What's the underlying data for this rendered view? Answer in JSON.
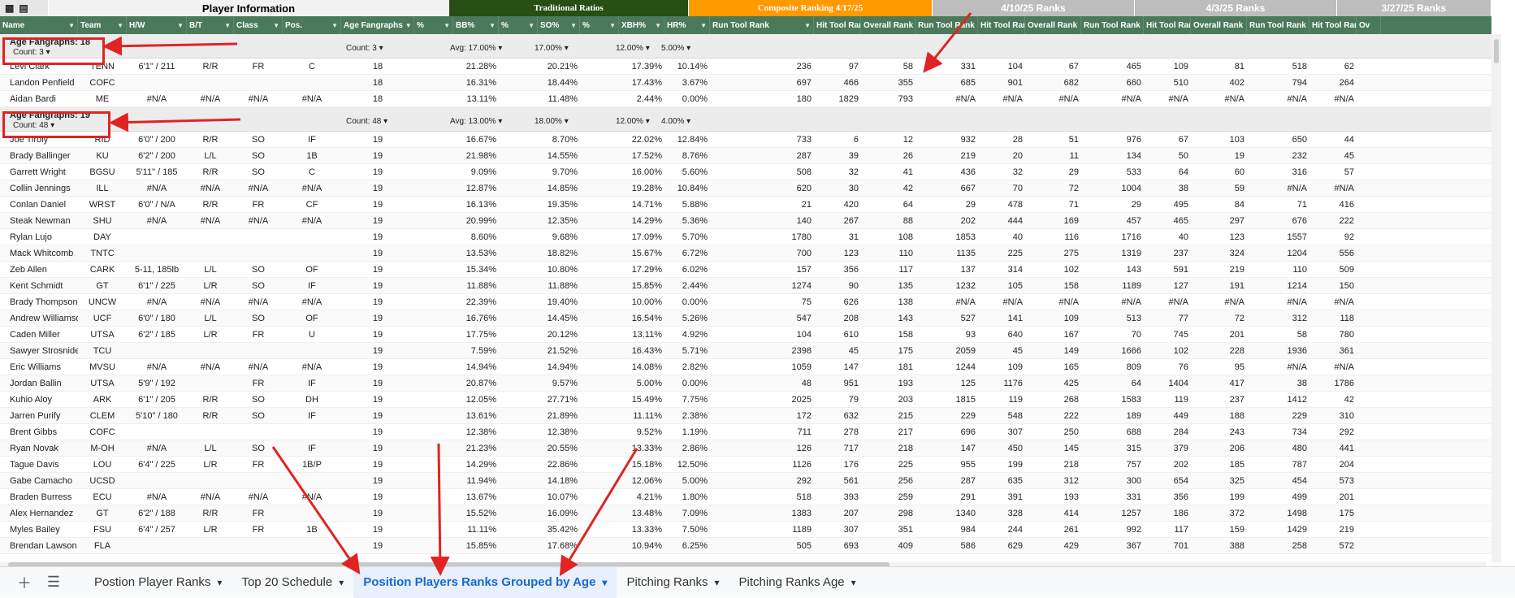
{
  "bands": {
    "player": "Player Information",
    "trad": "Traditional Ratios",
    "comp": "Composite Ranking 4/17/25",
    "r1": "4/10/25 Ranks",
    "r2": "4/3/25 Ranks",
    "r3": "3/27/25 Ranks"
  },
  "headers": [
    "Name",
    "Team",
    "H/W",
    "B/T",
    "Class",
    "Pos.",
    "Age Fangraphs",
    "%",
    "BB%",
    "%",
    "SO%",
    "%",
    "XBH%",
    "HR%",
    "Run Tool Rank",
    "Hit Tool Rank",
    "Overall Rank",
    "Run Tool Rank",
    "Hit Tool Rank",
    "Overall Rank",
    "Run Tool Rank",
    "Hit Tool Rank",
    "Overall Rank",
    "Run Tool Rank",
    "Hit Tool Rank",
    "Ov"
  ],
  "groups": [
    {
      "title": "Age Fangraphs: 18",
      "count": "Count: 3",
      "agg": [
        "Count: 3",
        "Avg: 17.00%",
        "17.00%",
        "12.00%",
        "5.00%"
      ],
      "rows": [
        [
          "Levi Clark",
          "TENN",
          "6'1\" / 211",
          "R/R",
          "FR",
          "C",
          "18",
          "21.28%",
          "20.21%",
          "17.39%",
          "10.14%",
          "236",
          "97",
          "58",
          "331",
          "104",
          "67",
          "465",
          "109",
          "81",
          "518",
          "62"
        ],
        [
          "Landon Penfield",
          "COFC",
          "",
          "",
          "",
          "",
          "18",
          "16.31%",
          "18.44%",
          "17.43%",
          "3.67%",
          "697",
          "466",
          "355",
          "685",
          "901",
          "682",
          "660",
          "510",
          "402",
          "794",
          "264"
        ],
        [
          "Aidan Bardi",
          "ME",
          "#N/A",
          "#N/A",
          "#N/A",
          "#N/A",
          "18",
          "13.11%",
          "11.48%",
          "2.44%",
          "0.00%",
          "180",
          "1829",
          "793",
          "#N/A",
          "#N/A",
          "#N/A",
          "#N/A",
          "#N/A",
          "#N/A",
          "#N/A",
          "#N/A"
        ]
      ]
    },
    {
      "title": "Age Fangraphs: 19",
      "count": "Count: 48",
      "agg": [
        "Count: 48",
        "Avg: 13.00%",
        "18.00%",
        "12.00%",
        "4.00%"
      ],
      "rows": [
        [
          "Joe Tiroly",
          "RID",
          "6'0\" / 200",
          "R/R",
          "SO",
          "IF",
          "19",
          "16.67%",
          "8.70%",
          "22.02%",
          "12.84%",
          "733",
          "6",
          "12",
          "932",
          "28",
          "51",
          "976",
          "67",
          "103",
          "650",
          "44"
        ],
        [
          "Brady Ballinger",
          "KU",
          "6'2\" / 200",
          "L/L",
          "SO",
          "1B",
          "19",
          "21.98%",
          "14.55%",
          "17.52%",
          "8.76%",
          "287",
          "39",
          "26",
          "219",
          "20",
          "11",
          "134",
          "50",
          "19",
          "232",
          "45"
        ],
        [
          "Garrett Wright",
          "BGSU",
          "5'11\" / 185",
          "R/R",
          "SO",
          "C",
          "19",
          "9.09%",
          "9.70%",
          "16.00%",
          "5.60%",
          "508",
          "32",
          "41",
          "436",
          "32",
          "29",
          "533",
          "64",
          "60",
          "316",
          "57"
        ],
        [
          "Collin Jennings",
          "ILL",
          "#N/A",
          "#N/A",
          "#N/A",
          "#N/A",
          "19",
          "12.87%",
          "14.85%",
          "19.28%",
          "10.84%",
          "620",
          "30",
          "42",
          "667",
          "70",
          "72",
          "1004",
          "38",
          "59",
          "#N/A",
          "#N/A"
        ],
        [
          "Conlan Daniel",
          "WRST",
          "6'0\" / N/A",
          "R/R",
          "FR",
          "CF",
          "19",
          "16.13%",
          "19.35%",
          "14.71%",
          "5.88%",
          "21",
          "420",
          "64",
          "29",
          "478",
          "71",
          "29",
          "495",
          "84",
          "71",
          "416"
        ],
        [
          "Steak Newman",
          "SHU",
          "#N/A",
          "#N/A",
          "#N/A",
          "#N/A",
          "19",
          "20.99%",
          "12.35%",
          "14.29%",
          "5.36%",
          "140",
          "267",
          "88",
          "202",
          "444",
          "169",
          "457",
          "465",
          "297",
          "676",
          "222"
        ],
        [
          "Rylan Lujo",
          "DAY",
          "",
          "",
          "",
          "",
          "19",
          "8.60%",
          "9.68%",
          "17.09%",
          "5.70%",
          "1780",
          "31",
          "108",
          "1853",
          "40",
          "116",
          "1716",
          "40",
          "123",
          "1557",
          "92"
        ],
        [
          "Mack Whitcomb",
          "TNTC",
          "",
          "",
          "",
          "",
          "19",
          "13.53%",
          "18.82%",
          "15.67%",
          "6.72%",
          "700",
          "123",
          "110",
          "1135",
          "225",
          "275",
          "1319",
          "237",
          "324",
          "1204",
          "556"
        ],
        [
          "Zeb Allen",
          "CARK",
          "5-11, 185lb",
          "L/L",
          "SO",
          "OF",
          "19",
          "15.34%",
          "10.80%",
          "17.29%",
          "6.02%",
          "157",
          "356",
          "117",
          "137",
          "314",
          "102",
          "143",
          "591",
          "219",
          "110",
          "509"
        ],
        [
          "Kent Schmidt",
          "GT",
          "6'1\" / 225",
          "L/R",
          "SO",
          "IF",
          "19",
          "11.88%",
          "11.88%",
          "15.85%",
          "2.44%",
          "1274",
          "90",
          "135",
          "1232",
          "105",
          "158",
          "1189",
          "127",
          "191",
          "1214",
          "150"
        ],
        [
          "Brady Thompson",
          "UNCW",
          "#N/A",
          "#N/A",
          "#N/A",
          "#N/A",
          "19",
          "22.39%",
          "19.40%",
          "10.00%",
          "0.00%",
          "75",
          "626",
          "138",
          "#N/A",
          "#N/A",
          "#N/A",
          "#N/A",
          "#N/A",
          "#N/A",
          "#N/A",
          "#N/A"
        ],
        [
          "Andrew Williamson",
          "UCF",
          "6'0\" / 180",
          "L/L",
          "SO",
          "OF",
          "19",
          "16.76%",
          "14.45%",
          "16.54%",
          "5.26%",
          "547",
          "208",
          "143",
          "527",
          "141",
          "109",
          "513",
          "77",
          "72",
          "312",
          "118"
        ],
        [
          "Caden Miller",
          "UTSA",
          "6'2\" / 185",
          "L/R",
          "FR",
          "U",
          "19",
          "17.75%",
          "20.12%",
          "13.11%",
          "4.92%",
          "104",
          "610",
          "158",
          "93",
          "640",
          "167",
          "70",
          "745",
          "201",
          "58",
          "780"
        ],
        [
          "Sawyer Strosnider",
          "TCU",
          "",
          "",
          "",
          "",
          "19",
          "7.59%",
          "21.52%",
          "16.43%",
          "5.71%",
          "2398",
          "45",
          "175",
          "2059",
          "45",
          "149",
          "1666",
          "102",
          "228",
          "1936",
          "361"
        ],
        [
          "Eric Williams",
          "MVSU",
          "#N/A",
          "#N/A",
          "#N/A",
          "#N/A",
          "19",
          "14.94%",
          "14.94%",
          "14.08%",
          "2.82%",
          "1059",
          "147",
          "181",
          "1244",
          "109",
          "165",
          "809",
          "76",
          "95",
          "#N/A",
          "#N/A"
        ],
        [
          "Jordan Ballin",
          "UTSA",
          "5'9\" / 192",
          "",
          "FR",
          "IF",
          "19",
          "20.87%",
          "9.57%",
          "5.00%",
          "0.00%",
          "48",
          "951",
          "193",
          "125",
          "1176",
          "425",
          "64",
          "1404",
          "417",
          "38",
          "1786"
        ],
        [
          "Kuhio Aloy",
          "ARK",
          "6'1\" / 205",
          "R/R",
          "SO",
          "DH",
          "19",
          "12.05%",
          "27.71%",
          "15.49%",
          "7.75%",
          "2025",
          "79",
          "203",
          "1815",
          "119",
          "268",
          "1583",
          "119",
          "237",
          "1412",
          "42"
        ],
        [
          "Jarren Purify",
          "CLEM",
          "5'10\" / 180",
          "R/R",
          "SO",
          "IF",
          "19",
          "13.61%",
          "21.89%",
          "11.11%",
          "2.38%",
          "172",
          "632",
          "215",
          "229",
          "548",
          "222",
          "189",
          "449",
          "188",
          "229",
          "310"
        ],
        [
          "Brent Gibbs",
          "COFC",
          "",
          "",
          "",
          "",
          "19",
          "12.38%",
          "12.38%",
          "9.52%",
          "1.19%",
          "711",
          "278",
          "217",
          "696",
          "307",
          "250",
          "688",
          "284",
          "243",
          "734",
          "292"
        ],
        [
          "Ryan Novak",
          "M-OH",
          "#N/A",
          "L/L",
          "SO",
          "IF",
          "19",
          "21.23%",
          "20.55%",
          "13.33%",
          "2.86%",
          "126",
          "717",
          "218",
          "147",
          "450",
          "145",
          "315",
          "379",
          "206",
          "480",
          "441"
        ],
        [
          "Tague Davis",
          "LOU",
          "6'4\" / 225",
          "L/R",
          "FR",
          "1B/P",
          "19",
          "14.29%",
          "22.86%",
          "15.18%",
          "12.50%",
          "1126",
          "176",
          "225",
          "955",
          "199",
          "218",
          "757",
          "202",
          "185",
          "787",
          "204"
        ],
        [
          "Gabe Camacho",
          "UCSD",
          "",
          "",
          "",
          "",
          "19",
          "11.94%",
          "14.18%",
          "12.06%",
          "5.00%",
          "292",
          "561",
          "256",
          "287",
          "635",
          "312",
          "300",
          "654",
          "325",
          "454",
          "573"
        ],
        [
          "Braden Burress",
          "ECU",
          "#N/A",
          "#N/A",
          "#N/A",
          "#N/A",
          "19",
          "13.67%",
          "10.07%",
          "4.21%",
          "1.80%",
          "518",
          "393",
          "259",
          "291",
          "391",
          "193",
          "331",
          "356",
          "199",
          "499",
          "201"
        ],
        [
          "Alex Hernandez",
          "GT",
          "6'2\" / 188",
          "R/R",
          "FR",
          "",
          "19",
          "15.52%",
          "16.09%",
          "13.48%",
          "7.09%",
          "1383",
          "207",
          "298",
          "1340",
          "328",
          "414",
          "1257",
          "186",
          "372",
          "1498",
          "175"
        ],
        [
          "Myles Bailey",
          "FSU",
          "6'4\" / 257",
          "L/R",
          "FR",
          "1B",
          "19",
          "11.11%",
          "35.42%",
          "13.33%",
          "7.50%",
          "1189",
          "307",
          "351",
          "984",
          "244",
          "261",
          "992",
          "117",
          "159",
          "1429",
          "219"
        ],
        [
          "Brendan Lawson",
          "FLA",
          "",
          "",
          "",
          "",
          "19",
          "15.85%",
          "17.68%",
          "10.94%",
          "6.25%",
          "505",
          "693",
          "409",
          "586",
          "629",
          "429",
          "367",
          "701",
          "388",
          "258",
          "572"
        ]
      ]
    }
  ],
  "tabs": [
    {
      "label": "Postion Player Ranks",
      "active": false
    },
    {
      "label": "Top 20 Schedule",
      "active": false
    },
    {
      "label": "Position Players Ranks Grouped by Age",
      "active": true
    },
    {
      "label": "Pitching Ranks",
      "active": false
    },
    {
      "label": "Pitching Ranks Age",
      "active": false
    }
  ],
  "icons": {
    "add": "add-sheet-icon",
    "menu": "all-sheets-icon",
    "caret": "chevron-down-icon",
    "filter": "filter-icon"
  },
  "colors": {
    "header_green": "#4b7a5a",
    "trad_green": "#274e13",
    "composite_orange": "#ff9900",
    "active_tab": "#1967d2",
    "annotation_red": "#e02424"
  }
}
